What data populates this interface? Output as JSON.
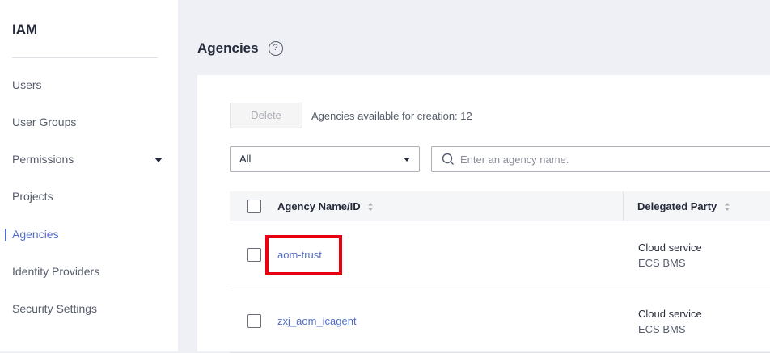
{
  "sidebar": {
    "title": "IAM",
    "items": [
      {
        "label": "Users"
      },
      {
        "label": "User Groups"
      },
      {
        "label": "Permissions"
      },
      {
        "label": "Projects"
      },
      {
        "label": "Agencies"
      },
      {
        "label": "Identity Providers"
      },
      {
        "label": "Security Settings"
      }
    ]
  },
  "page": {
    "title": "Agencies",
    "help_symbol": "?"
  },
  "toolbar": {
    "delete_label": "Delete",
    "quota_text": "Agencies available for creation: 12"
  },
  "filter": {
    "select_value": "All",
    "search_placeholder": "Enter an agency name."
  },
  "table": {
    "columns": [
      "Agency Name/ID",
      "Delegated Party"
    ],
    "rows": [
      {
        "name": "aom-trust",
        "party_type": "Cloud service",
        "party_value": "ECS BMS"
      },
      {
        "name": "zxj_aom_icagent",
        "party_type": "Cloud service",
        "party_value": "ECS BMS"
      }
    ]
  },
  "colors": {
    "accent": "#526ecc",
    "highlight": "#e60012"
  }
}
